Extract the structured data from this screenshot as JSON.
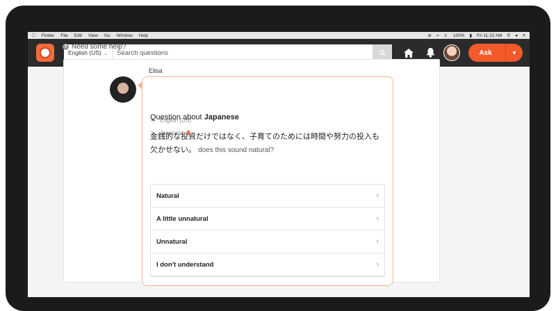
{
  "menubar": {
    "items": [
      "Finder",
      "File",
      "Edit",
      "View",
      "Go",
      "Window",
      "Help"
    ],
    "battery": "100%",
    "clock": "Fri 11:22 AM"
  },
  "header": {
    "language": "English (US)",
    "search_placeholder": "Search questions",
    "ask_label": "Ask"
  },
  "help_text": "Need some help?",
  "question": {
    "username": "Elisa",
    "native_language": "English (US)",
    "learning_language": "Japanese",
    "level_bars": "III",
    "title_prefix": "Question about",
    "title_language": "Japanese",
    "body_japanese": "金銭的な投資だけではなく、子育てのためには時間や努力の投入も欠かせない。",
    "body_english": "does this sound natural?"
  },
  "options": [
    {
      "label": "Natural"
    },
    {
      "label": "A little unnatural"
    },
    {
      "label": "Unnatural"
    },
    {
      "label": "I don't understand"
    }
  ],
  "colors": {
    "accent": "#f25a2a",
    "appbar": "#2b2b2b",
    "bubble_border": "#f5b493"
  }
}
